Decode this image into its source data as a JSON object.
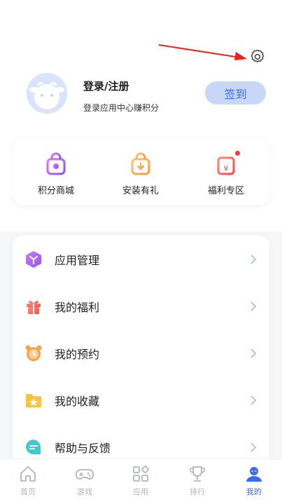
{
  "profile": {
    "title": "登录/注册",
    "subtitle": "登录应用中心赚积分",
    "signin_label": "签到"
  },
  "quick": [
    {
      "label": "积分商城",
      "icon": "shopping-bag-icon"
    },
    {
      "label": "安装有礼",
      "icon": "install-gift-icon"
    },
    {
      "label": "福利专区",
      "icon": "welfare-icon"
    }
  ],
  "menu": [
    {
      "label": "应用管理",
      "icon": "app-management-icon"
    },
    {
      "label": "我的福利",
      "icon": "gift-icon"
    },
    {
      "label": "我的预约",
      "icon": "alarm-clock-icon"
    },
    {
      "label": "我的收藏",
      "icon": "star-folder-icon"
    },
    {
      "label": "帮助与反馈",
      "icon": "chat-bubble-icon"
    }
  ],
  "nav": [
    {
      "label": "首页",
      "icon": "home-icon"
    },
    {
      "label": "游戏",
      "icon": "gamepad-icon"
    },
    {
      "label": "应用",
      "icon": "apps-icon"
    },
    {
      "label": "排行",
      "icon": "trophy-icon"
    },
    {
      "label": "我的",
      "icon": "user-icon",
      "active": true
    }
  ],
  "colors": {
    "accent": "#3b6cf0",
    "signin_bg": "#c8d6f8",
    "arrow_red": "#e8231f"
  }
}
